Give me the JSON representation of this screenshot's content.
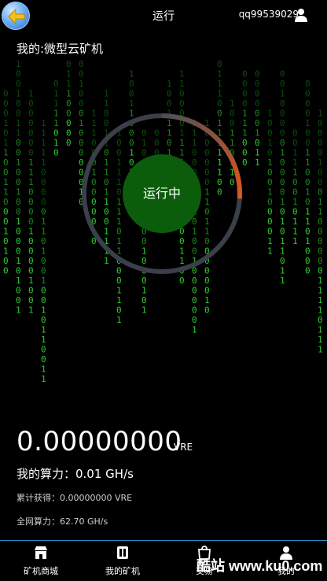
{
  "header": {
    "title": "运行",
    "username": "qq99539029"
  },
  "subtitle": "我的:微型云矿机",
  "status": {
    "label": "运行中",
    "progress": 0.26
  },
  "stats": {
    "balance": "0.00000000",
    "balance_unit": "VRE",
    "hashrate": "我的算力：0.01 GH/s",
    "earned": "累计获得：0.00000000 VRE",
    "network": "全网算力：62.70 GH/s"
  },
  "nav": [
    {
      "label": "矿机商城",
      "icon": "store-icon"
    },
    {
      "label": "我的矿机",
      "icon": "miner-icon"
    },
    {
      "label": "交易",
      "icon": "bag-icon"
    },
    {
      "label": "我的",
      "icon": "user-icon"
    }
  ],
  "watermark": "酷站 www.ku0.com",
  "colors": {
    "background": "#000000",
    "accent_green": "#0b5d0b",
    "ring_track": "#3a3f4a",
    "ring_progress": "#e0561c",
    "matrix_green": "#1fa01f",
    "nav_border": "#2a8fc4"
  }
}
